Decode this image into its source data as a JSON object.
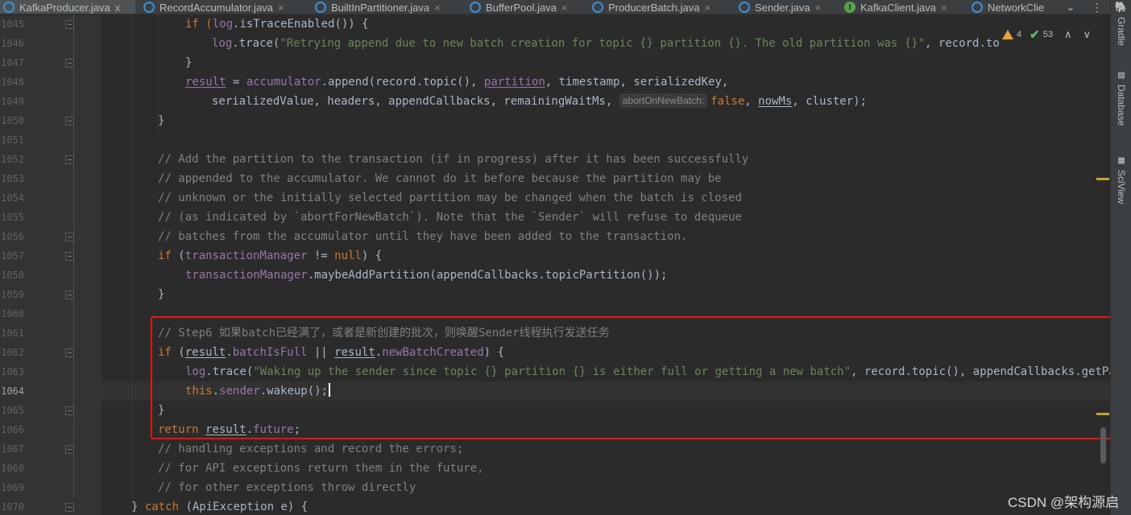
{
  "tabs": [
    {
      "name": "KafkaProducer.java",
      "active": true,
      "close": "x",
      "icon": "java-class-icon",
      "modified": false
    },
    {
      "name": "RecordAccumulator.java",
      "active": false,
      "close": "×",
      "icon": "java-class-icon",
      "modified": false
    },
    {
      "name": "BuiltInPartitioner.java",
      "active": false,
      "close": "×",
      "icon": "java-class-icon",
      "modified": false
    },
    {
      "name": "BufferPool.java",
      "active": false,
      "close": "×",
      "icon": "java-class-icon",
      "modified": false
    },
    {
      "name": "ProducerBatch.java",
      "active": false,
      "close": "×",
      "icon": "java-class-icon",
      "modified": false
    },
    {
      "name": "Sender.java",
      "active": false,
      "close": "×",
      "icon": "java-class-icon",
      "modified": true
    },
    {
      "name": "KafkaClient.java",
      "active": false,
      "close": "×",
      "icon": "java-interface-icon",
      "icon_letter": "I",
      "modified": false
    },
    {
      "name": "NetworkClie",
      "active": false,
      "close": "",
      "icon": "java-class-icon",
      "modified": false
    }
  ],
  "tab_overflow_glyph": "⌄",
  "tab_menu_glyph": "⋮",
  "inspections": {
    "warnings": "4",
    "ok": "53",
    "up": "∧",
    "down": "∨"
  },
  "line_numbers": [
    "1045",
    "1046",
    "1047",
    "1048",
    "1049",
    "1050",
    "1051",
    "1052",
    "1053",
    "1054",
    "1055",
    "1056",
    "1057",
    "1058",
    "1059",
    "1060",
    "1061",
    "1062",
    "1063",
    "1064",
    "1065",
    "1066",
    "1067",
    "1068",
    "1069",
    "1070"
  ],
  "current_line": "1064",
  "code": {
    "l1045": {
      "a": "if (",
      "b": "log",
      "c": ".isTraceEnabled()) {"
    },
    "l1046": {
      "a": "log",
      "b": ".trace(",
      "c": "\"Retrying append due to new batch creation for topic {} partition {}. The old partition was {}\"",
      "d": ", record.to"
    },
    "l1047": {
      "a": "}"
    },
    "l1048": {
      "a": "result",
      "b": " = ",
      "c": "accumulator",
      "d": ".append(record.topic(), ",
      "e": "partition",
      "f": ", timestamp, serializedKey,"
    },
    "l1049": {
      "a": "serializedValue, headers, appendCallbacks, remainingWaitMs, ",
      "hint": "abortOnNewBatch:",
      "b": "false",
      "c": ", ",
      "d": "nowMs",
      "e": ", cluster);"
    },
    "l1050": {
      "a": "}"
    },
    "l1052": "// Add the partition to the transaction (if in progress) after it has been successfully",
    "l1053": "// appended to the accumulator. We cannot do it before because the partition may be",
    "l1054": "// unknown or the initially selected partition may be changed when the batch is closed",
    "l1055": "// (as indicated by `abortForNewBatch`). Note that the `Sender` will refuse to dequeue",
    "l1056": "// batches from the accumulator until they have been added to the transaction.",
    "l1057": {
      "a": "if",
      "b": " (",
      "c": "transactionManager",
      "d": " != ",
      "e": "null",
      "f": ") {"
    },
    "l1058": {
      "a": "transactionManager",
      "b": ".maybeAddPartition(appendCallbacks.topicPartition());"
    },
    "l1059": {
      "a": "}"
    },
    "l1061": "// Step6 如果batch已经满了，或者是新创建的批次，则唤醒Sender线程执行发送任务",
    "l1062": {
      "a": "if",
      "b": " (",
      "c": "result",
      "d": ".",
      "e": "batchIsFull",
      "f": " || ",
      "g": "result",
      "h": ".",
      "i": "newBatchCreated",
      "j": ") {"
    },
    "l1063": {
      "a": "log",
      "b": ".trace(",
      "c": "\"Waking up the sender since topic {} partition {} is either full or getting a new batch\"",
      "d": ", record.topic(), appendCallbacks.getPa"
    },
    "l1064": {
      "a": "this",
      "b": ".",
      "c": "sender",
      "d": ".wakeup();"
    },
    "l1065": {
      "a": "}"
    },
    "l1066": {
      "a": "return",
      "b": " ",
      "c": "result",
      "d": ".",
      "e": "future",
      "f": ";"
    },
    "l1067": "// handling exceptions and record the errors;",
    "l1068": "// for API exceptions return them in the future,",
    "l1069": "// for other exceptions throw directly",
    "l1070": {
      "a": "} ",
      "b": "catch",
      "c": " (ApiException e) {"
    }
  },
  "right_tools": [
    {
      "name": "Gradle",
      "icon": "gradle-icon",
      "glyph": "🐘"
    },
    {
      "name": "Database",
      "icon": "database-icon",
      "glyph": "▤"
    },
    {
      "name": "SciView",
      "icon": "sciview-icon",
      "glyph": "▦"
    }
  ],
  "watermark": "CSDN @架构源启",
  "colors": {
    "keyword": "#cc7832",
    "field": "#9876aa",
    "string": "#6a8759",
    "comment": "#808080",
    "annotation_box": "#ee1111"
  }
}
